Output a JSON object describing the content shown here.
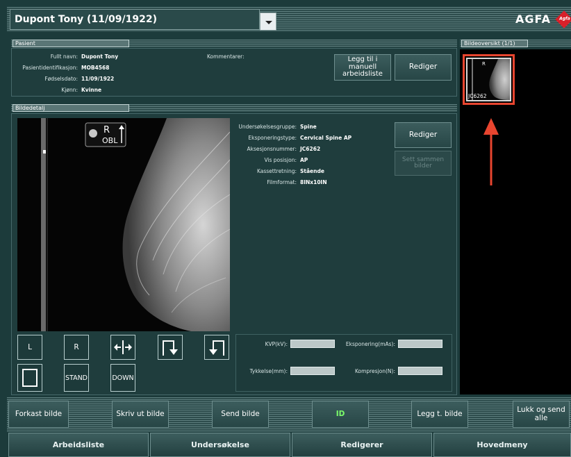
{
  "header": {
    "patient_title": "Dupont Tony (11/09/1922)",
    "brand": "AGFA",
    "brand_mark": "Agfa"
  },
  "patient": {
    "section_label": "Pasient",
    "fields": [
      {
        "label": "Fullt navn:",
        "value": "Dupont Tony"
      },
      {
        "label": "Pasientidentifikasjon:",
        "value": "MOB4568"
      },
      {
        "label": "Fødselsdato:",
        "value": "11/09/1922"
      },
      {
        "label": "Kjønn:",
        "value": "Kvinne"
      }
    ],
    "comments_label": "Kommentarer:",
    "add_to_worklist_label": "Legg til i manuell arbeidsliste",
    "edit_label": "Rediger"
  },
  "image_detail": {
    "section_label": "Bildedetalj",
    "marker_letter": "R",
    "marker_text": "OBL",
    "fields": [
      {
        "label": "Undersøkelsesgruppe:",
        "value": "Spine"
      },
      {
        "label": "Eksponeringstype:",
        "value": "Cervical Spine AP"
      },
      {
        "label": "Aksesjonsnummer:",
        "value": "JC6262"
      },
      {
        "label": "Vis posisjon:",
        "value": "AP"
      },
      {
        "label": "Kassettretning:",
        "value": "Stående"
      },
      {
        "label": "Filmformat:",
        "value": "8INx10IN"
      }
    ],
    "edit_label": "Rediger",
    "merge_label": "Sett sammen bilder"
  },
  "controls": {
    "l_label": "L",
    "r_label": "R",
    "stand_label": "STAND",
    "down_label": "DOWN"
  },
  "exposure": {
    "kvp_label": "KVP(kV):",
    "mas_label": "Eksponering(mAs):",
    "thickness_label": "Tykkelse(mm):",
    "compression_label": "Kompresjon(N):",
    "kvp_value": "",
    "mas_value": "",
    "thickness_value": "",
    "compression_value": ""
  },
  "overview": {
    "section_label": "Bildeoversikt (1/1)",
    "thumb_id": "JC6262",
    "thumb_marker": "R"
  },
  "actions": {
    "discard": "Forkast bilde",
    "print": "Skriv ut bilde",
    "send": "Send bilde",
    "id": "ID",
    "add_image": "Legg t. bilde",
    "close_send": "Lukk og send alle"
  },
  "tabs": [
    "Arbeidsliste",
    "Undersøkelse",
    "Redigerer",
    "Hovedmeny"
  ],
  "colors": {
    "background": "#1c3b3b",
    "highlight": "#e8452f",
    "id_green": "#7cff6b"
  }
}
